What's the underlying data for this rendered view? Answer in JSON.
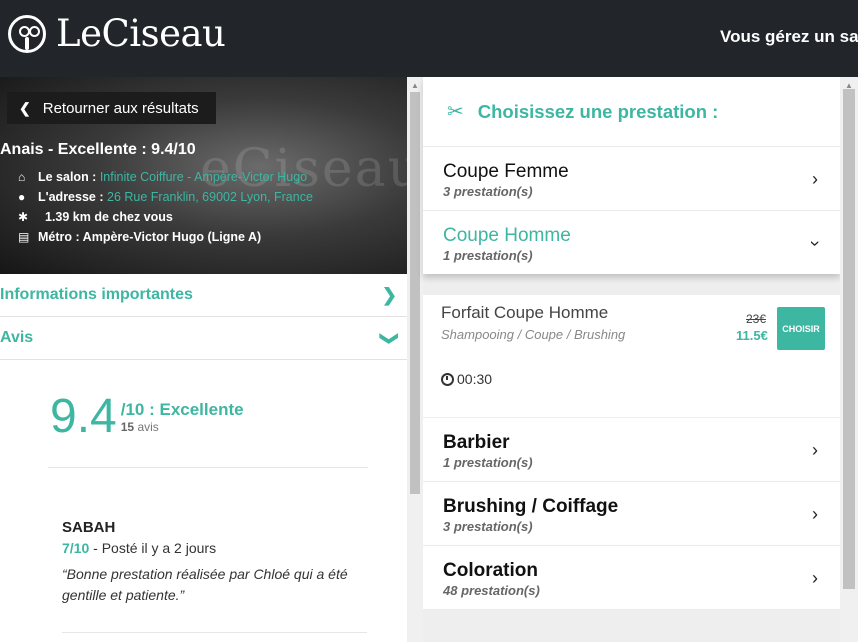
{
  "header": {
    "brand": "LeCiseau",
    "pro_link": "Vous gérez un salo"
  },
  "hero": {
    "back_label": "Retourner aux résultats",
    "watermark": "eCiseau",
    "salon_title": "Anais - Excellente : 9.4/10",
    "salon_label": "Le salon :",
    "salon_value": "Infinite Coiffure - Ampère-Victor Hugo",
    "address_label": "L'adresse :",
    "address_value": "26 Rue Franklin, 69002 Lyon, France",
    "distance": "1.39 km de chez vous",
    "metro": "Métro : Ampère-Victor Hugo (Ligne A)"
  },
  "left": {
    "info_label": "Informations importantes",
    "reviews_label": "Avis",
    "score": "9.4",
    "score_text": "/10 : Excellente",
    "review_count": "15",
    "review_count_suffix": "avis",
    "review": {
      "author": "SABAH",
      "score": "7/10",
      "posted": " - Posté il y a 2 jours",
      "text": "“Bonne prestation réalisée par Chloé qui a été gentille et patiente.”"
    }
  },
  "right": {
    "title": "Choisissez une prestation :",
    "categories_top": [
      {
        "name": "Coupe Femme",
        "count": "3 prestation(s)"
      },
      {
        "name": "Coupe Homme",
        "count": "1 prestation(s)"
      }
    ],
    "service": {
      "name": "Forfait Coupe Homme",
      "description": "Shampooing / Coupe / Brushing",
      "old_price": "23€",
      "new_price": "11.5€",
      "button": "CHOISIR",
      "duration": "00:30"
    },
    "categories_bottom": [
      {
        "name": "Barbier",
        "count": "1 prestation(s)"
      },
      {
        "name": "Brushing / Coiffage",
        "count": "3 prestation(s)"
      },
      {
        "name": "Coloration",
        "count": "48 prestation(s)"
      }
    ]
  },
  "colors": {
    "accent": "#3db6a2",
    "header_bg": "#22262a"
  }
}
